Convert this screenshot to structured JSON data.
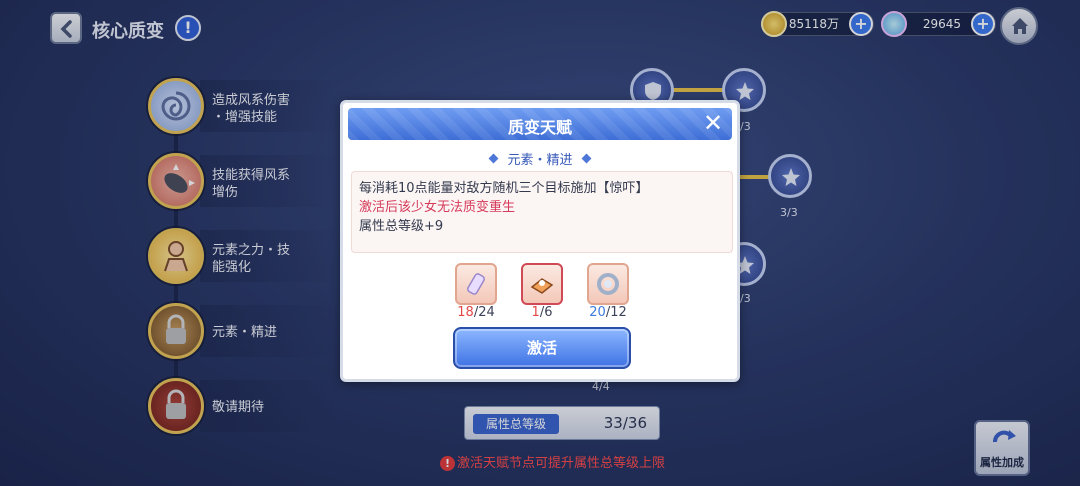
{
  "header": {
    "title": "核心质变",
    "currency": [
      {
        "icon": "gold-coin-icon",
        "value": "85118万"
      },
      {
        "icon": "gem-icon",
        "value": "29645"
      }
    ]
  },
  "tree": {
    "nodes": [
      {
        "label_line1": "造成风系伤害",
        "label_line2": "・增强技能"
      },
      {
        "label_line1": "技能获得风系",
        "label_line2": "增伤"
      },
      {
        "label_line1": "元素之力・技",
        "label_line2": "能强化"
      },
      {
        "label_line1": "元素・精进",
        "label_line2": ""
      },
      {
        "label_line1": "敬请期待",
        "label_line2": ""
      }
    ],
    "right_counts": [
      "/3",
      "3/3",
      "/3",
      "4/4"
    ]
  },
  "attributes": {
    "label": "属性总等级",
    "value": "33/36",
    "warning": "激活天赋节点可提升属性总等级上限",
    "bonus_button": "属性加成"
  },
  "dialog": {
    "title": "质变天赋",
    "subtitle": "元素・精进",
    "desc_line1": "每消耗10点能量对敌方随机三个目标施加【惊吓】",
    "desc_line2": "激活后该少女无法质变重生",
    "desc_line3": "属性总等级+9",
    "materials": [
      {
        "icon": "potion-vial-icon",
        "have": "18",
        "need": "/24"
      },
      {
        "icon": "manual-book-icon",
        "have": "1",
        "need": "/6"
      },
      {
        "icon": "silver-ring-icon",
        "have": "20",
        "need": "/12"
      }
    ],
    "activate_label": "激活"
  }
}
